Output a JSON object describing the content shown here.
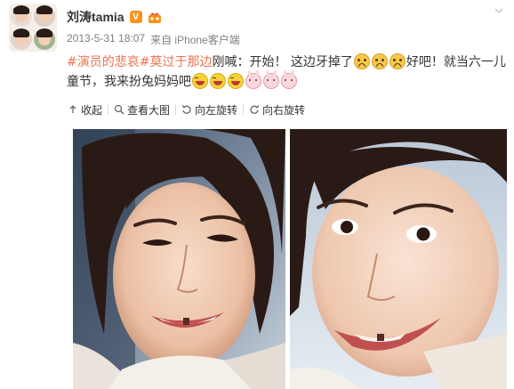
{
  "user": {
    "name": "刘涛tamia",
    "verified_badge": "V",
    "level_icon": "vip-crown-icon"
  },
  "meta": {
    "time": "2013-5-31 18:07",
    "client": "来自 iPhone客户端"
  },
  "post": {
    "hashtag": "#演员的悲哀#",
    "title_link": "莫过于那边",
    "text_before_emoji": "刚喊：开始！ 这边牙掉了",
    "text_after_emoji": "好吧！就当六一儿童节，我来扮兔妈妈吧",
    "emoji_sad": [
      "sad-face-icon",
      "sad-face-icon",
      "sad-face-icon"
    ],
    "emoji_end": [
      "laugh-face-icon",
      "laugh-face-icon",
      "laugh-face-icon",
      "rabbit-face-icon",
      "rabbit-face-icon",
      "rabbit-face-icon"
    ]
  },
  "toolbar": {
    "collapse_label": "收起",
    "view_large_label": "查看大图",
    "rotate_left_label": "向左旋转",
    "rotate_right_label": "向右旋转"
  },
  "colors": {
    "accent": "#eb7350",
    "meta": "#808080",
    "text": "#333333",
    "badge": "#f99419"
  },
  "images": [
    {
      "subject": "smiling woman, tooth gap, close-up selfie"
    },
    {
      "subject": "woman making funny face, tooth gap, close-up selfie"
    }
  ]
}
